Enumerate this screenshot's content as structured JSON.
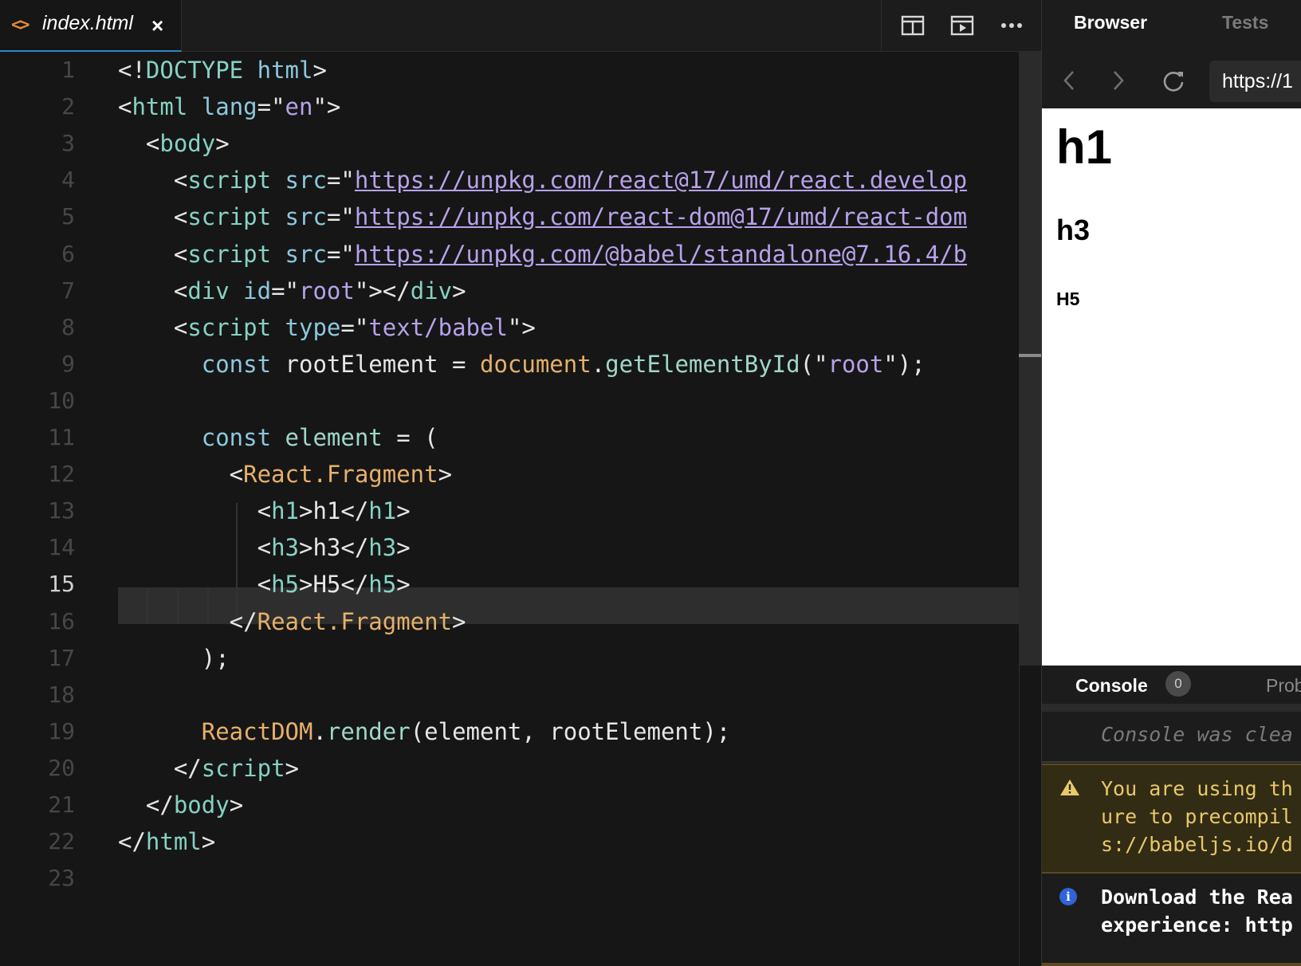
{
  "editor": {
    "tab": {
      "icon": "code-icon",
      "label": "index.html",
      "close": "×"
    },
    "actions": [
      "split-editor-icon",
      "preview-icon",
      "more-icon"
    ],
    "active_line": 15,
    "line_numbers": [
      "1",
      "2",
      "3",
      "4",
      "5",
      "6",
      "7",
      "8",
      "9",
      "10",
      "11",
      "12",
      "13",
      "14",
      "15",
      "16",
      "17",
      "18",
      "19",
      "20",
      "21",
      "22",
      "23"
    ],
    "lines": [
      [
        [
          "t-tag",
          "<!"
        ],
        [
          "t-name",
          "DOCTYPE"
        ],
        [
          "t-tag",
          " "
        ],
        [
          "t-attr",
          "html"
        ],
        [
          "t-tag",
          ">"
        ]
      ],
      [
        [
          "t-tag",
          "<"
        ],
        [
          "t-name",
          "html"
        ],
        [
          "t-tag",
          " "
        ],
        [
          "t-attr",
          "lang"
        ],
        [
          "t-tag",
          "=\""
        ],
        [
          "t-str",
          "en"
        ],
        [
          "t-tag",
          "\">"
        ]
      ],
      [
        [
          "t-tag",
          "  <"
        ],
        [
          "t-name",
          "body"
        ],
        [
          "t-tag",
          ">"
        ]
      ],
      [
        [
          "t-tag",
          "    <"
        ],
        [
          "t-name",
          "script"
        ],
        [
          "t-tag",
          " "
        ],
        [
          "t-attr",
          "src"
        ],
        [
          "t-tag",
          "=\""
        ],
        [
          "t-link",
          "https://unpkg.com/react@17/umd/react.develop"
        ]
      ],
      [
        [
          "t-tag",
          "    <"
        ],
        [
          "t-name",
          "script"
        ],
        [
          "t-tag",
          " "
        ],
        [
          "t-attr",
          "src"
        ],
        [
          "t-tag",
          "=\""
        ],
        [
          "t-link",
          "https://unpkg.com/react-dom@17/umd/react-dom"
        ]
      ],
      [
        [
          "t-tag",
          "    <"
        ],
        [
          "t-name",
          "script"
        ],
        [
          "t-tag",
          " "
        ],
        [
          "t-attr",
          "src"
        ],
        [
          "t-tag",
          "=\""
        ],
        [
          "t-link",
          "https://unpkg.com/@babel/standalone@7.16.4/b"
        ]
      ],
      [
        [
          "t-tag",
          "    <"
        ],
        [
          "t-name",
          "div"
        ],
        [
          "t-tag",
          " "
        ],
        [
          "t-attr",
          "id"
        ],
        [
          "t-tag",
          "=\""
        ],
        [
          "t-str",
          "root"
        ],
        [
          "t-tag",
          "\"></"
        ],
        [
          "t-name",
          "div"
        ],
        [
          "t-tag",
          ">"
        ]
      ],
      [
        [
          "t-tag",
          "    <"
        ],
        [
          "t-name",
          "script"
        ],
        [
          "t-tag",
          " "
        ],
        [
          "t-attr",
          "type"
        ],
        [
          "t-tag",
          "=\""
        ],
        [
          "t-str",
          "text/babel"
        ],
        [
          "t-tag",
          "\">"
        ]
      ],
      [
        [
          "t-tag",
          "      "
        ],
        [
          "t-kw",
          "const"
        ],
        [
          "t-tag",
          " rootElement = "
        ],
        [
          "t-obj",
          "document"
        ],
        [
          "t-tag",
          "."
        ],
        [
          "t-fn",
          "getElementById"
        ],
        [
          "t-tag",
          "(\""
        ],
        [
          "t-str",
          "root"
        ],
        [
          "t-tag",
          "\");"
        ]
      ],
      [],
      [
        [
          "t-tag",
          "      "
        ],
        [
          "t-kw",
          "const"
        ],
        [
          "t-tag",
          " "
        ],
        [
          "t-fn",
          "element"
        ],
        [
          "t-tag",
          " = ("
        ]
      ],
      [
        [
          "t-tag",
          "        <"
        ],
        [
          "t-comp",
          "React.Fragment"
        ],
        [
          "t-tag",
          ">"
        ]
      ],
      [
        [
          "t-tag",
          "          <"
        ],
        [
          "t-name",
          "h1"
        ],
        [
          "t-tag",
          ">h1</"
        ],
        [
          "t-name",
          "h1"
        ],
        [
          "t-tag",
          ">"
        ]
      ],
      [
        [
          "t-tag",
          "          <"
        ],
        [
          "t-name",
          "h3"
        ],
        [
          "t-tag",
          ">h3</"
        ],
        [
          "t-name",
          "h3"
        ],
        [
          "t-tag",
          ">"
        ]
      ],
      [
        [
          "t-tag",
          "          <"
        ],
        [
          "t-name",
          "h5"
        ],
        [
          "t-tag",
          ">H5</"
        ],
        [
          "t-name",
          "h5"
        ],
        [
          "t-tag",
          ">"
        ]
      ],
      [
        [
          "t-tag",
          "        </"
        ],
        [
          "t-comp",
          "React.Fragment"
        ],
        [
          "t-tag",
          ">"
        ]
      ],
      [
        [
          "t-tag",
          "      );"
        ]
      ],
      [],
      [
        [
          "t-tag",
          "      "
        ],
        [
          "t-obj",
          "ReactDOM"
        ],
        [
          "t-tag",
          "."
        ],
        [
          "t-fn",
          "render"
        ],
        [
          "t-tag",
          "(element, rootElement);"
        ]
      ],
      [
        [
          "t-tag",
          "    </"
        ],
        [
          "t-name",
          "script"
        ],
        [
          "t-tag",
          ">"
        ]
      ],
      [
        [
          "t-tag",
          "  </"
        ],
        [
          "t-name",
          "body"
        ],
        [
          "t-tag",
          ">"
        ]
      ],
      [
        [
          "t-tag",
          "</"
        ],
        [
          "t-name",
          "html"
        ],
        [
          "t-tag",
          ">"
        ]
      ],
      []
    ]
  },
  "panel": {
    "tabs": [
      {
        "label": "Browser",
        "active": true
      },
      {
        "label": "Tests",
        "active": false
      }
    ],
    "nav": {
      "back": "‹",
      "forward": "›",
      "url": "https://1"
    },
    "preview": {
      "h1": "h1",
      "h3": "h3",
      "h5": "H5"
    },
    "console": {
      "label": "Console",
      "count": "0",
      "next_tab": "Prob",
      "cleared": "Console was clea",
      "warning_lines": [
        "You are using th",
        "ure to precompil",
        "s://babeljs.io/d"
      ],
      "info_lines": [
        "Download the Rea",
        "experience: http"
      ]
    }
  },
  "colors": {
    "accent": "#2f86c9",
    "editor_bg": "#161616",
    "warning_bg": "#332c14",
    "warning_text": "#e8c96b"
  }
}
